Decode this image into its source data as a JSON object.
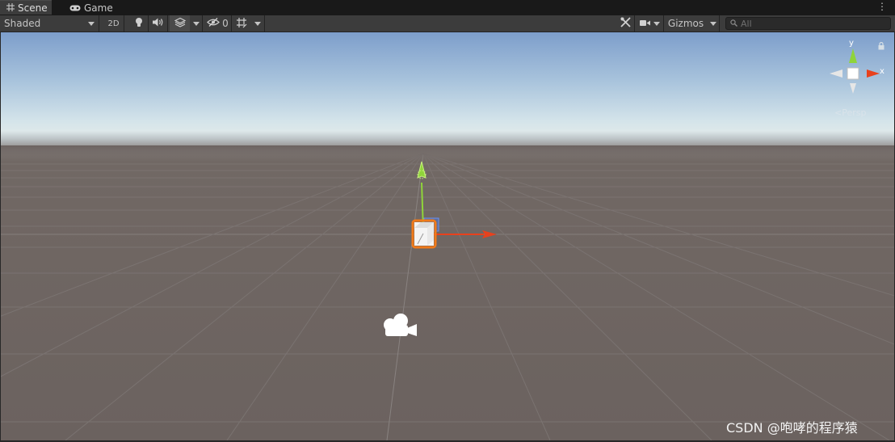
{
  "tabs": {
    "scene_label": "Scene",
    "scene_icon": "grid-icon",
    "game_label": "Game",
    "game_icon": "gamepad-icon",
    "menu_label": "⋮"
  },
  "toolbar": {
    "shading_mode": "Shaded",
    "toggle_2d": "2D",
    "hidden_count": "0",
    "gizmos_label": "Gizmos",
    "search_placeholder": "All"
  },
  "viewport": {
    "persp_label": "<Persp",
    "gizmo_axis_y": "y",
    "gizmo_axis_x": "x",
    "watermark": "CSDN @咆哮的程序猿"
  },
  "colors": {
    "x_axis": "#e8411d",
    "y_axis": "#8fd43a",
    "z_axis": "#4a78e0",
    "selection_outline": "#f07a1a",
    "ground": "#6b625f",
    "sky_top": "#7d9ecb"
  }
}
